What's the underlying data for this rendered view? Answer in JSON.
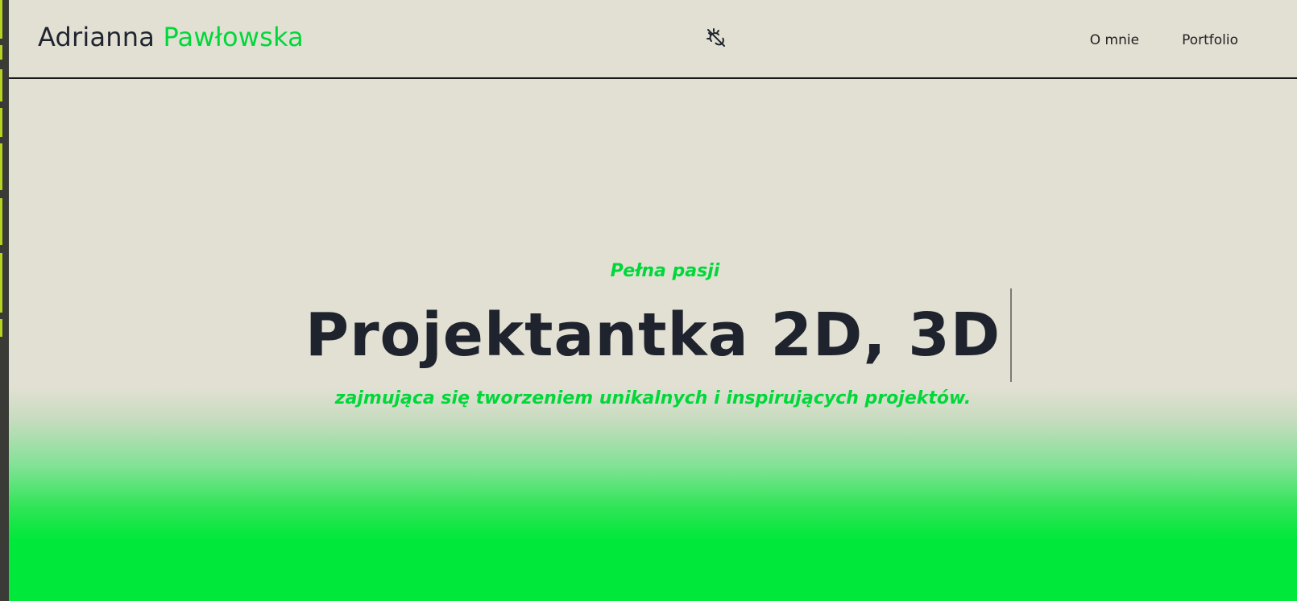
{
  "header": {
    "brand_first": "Adrianna",
    "brand_last": "Pawłowska",
    "theme_toggle_icon": "sun-moon-toggle-icon",
    "nav": [
      {
        "label": "O mnie"
      },
      {
        "label": "Portfolio"
      }
    ]
  },
  "hero": {
    "pre": "Pełna pasji",
    "title": "Projektantka 2D, 3D",
    "subtitle": "zajmująca się tworzeniem unikalnych i inspirujących projektów."
  },
  "colors": {
    "background": "#e2e0d3",
    "accent": "#00d83a",
    "text": "#1f232d",
    "gradient_bottom": "#00e83a"
  }
}
